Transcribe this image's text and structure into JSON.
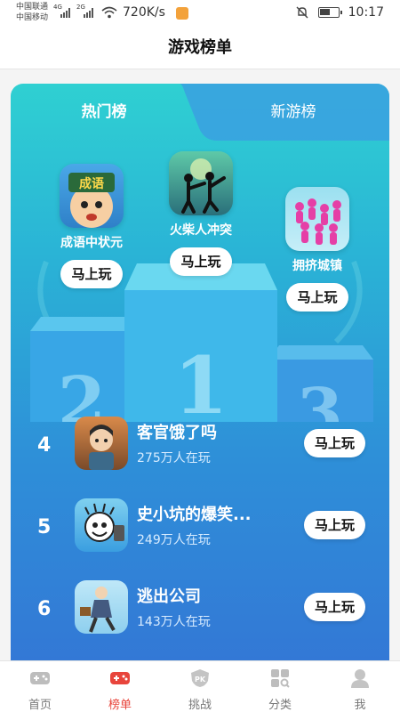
{
  "status_bar": {
    "carrier1": "中国联通",
    "carrier2": "中国移动",
    "net1": "4G",
    "net2": "2G",
    "speed": "720K/s",
    "time": "10:17"
  },
  "header": {
    "title": "游戏榜单"
  },
  "tabs": [
    {
      "label": "热门榜",
      "active": true
    },
    {
      "label": "新游榜",
      "active": false
    }
  ],
  "top3": [
    {
      "rank": 1,
      "name": "火柴人冲突",
      "button": "马上玩"
    },
    {
      "rank": 2,
      "name": "成语中状元",
      "button": "马上玩",
      "icon_text": "成语"
    },
    {
      "rank": 3,
      "name": "拥挤城镇",
      "button": "马上玩"
    }
  ],
  "podium_numbers": [
    "2",
    "1",
    "3"
  ],
  "rank_list": [
    {
      "rank": "4",
      "name": "客官饿了吗",
      "players": "275万人在玩",
      "button": "马上玩"
    },
    {
      "rank": "5",
      "name": "史小坑的爆笑...",
      "players": "249万人在玩",
      "button": "马上玩"
    },
    {
      "rank": "6",
      "name": "逃出公司",
      "players": "143万人在玩",
      "button": "马上玩"
    }
  ],
  "bottom_nav": [
    {
      "label": "首页",
      "icon": "gamepad-icon",
      "active": false
    },
    {
      "label": "榜单",
      "icon": "gamepad-icon",
      "active": true
    },
    {
      "label": "挑战",
      "icon": "pk-shield-icon",
      "active": false
    },
    {
      "label": "分类",
      "icon": "category-grid-icon",
      "active": false
    },
    {
      "label": "我",
      "icon": "user-icon",
      "active": false
    }
  ],
  "colors": {
    "accent": "#e8453c",
    "card_top": "#2fd0d2",
    "card_bottom": "#3378d6"
  }
}
